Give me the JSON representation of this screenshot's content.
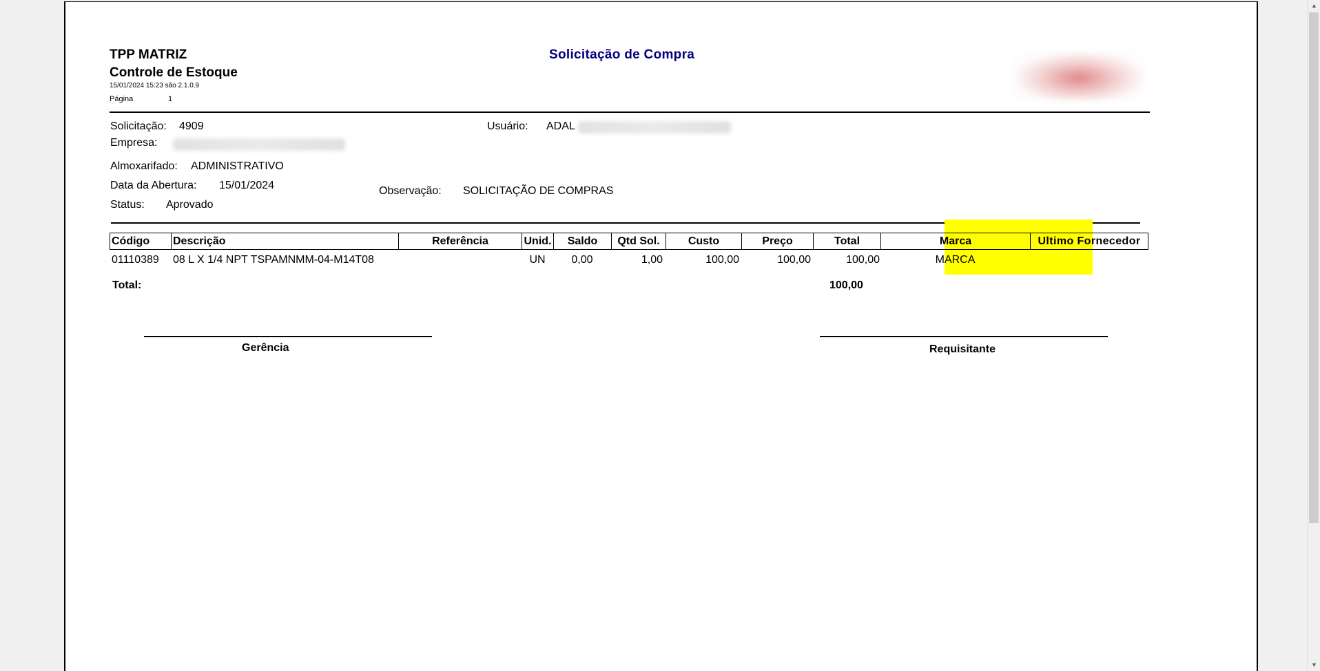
{
  "header": {
    "company": "TPP MATRIZ",
    "module": "Controle de Estoque",
    "datetime_version": "15/01/2024 15:23 são 2.1.0.9",
    "page_label": "Página",
    "page_number": "1",
    "report_title": "Solicitação de Compra"
  },
  "fields": {
    "solicitacao_label": "Solicitação:",
    "solicitacao_value": "4909",
    "usuario_label": "Usuário:",
    "usuario_value": "ADAL",
    "empresa_label": "Empresa:",
    "almoxarifado_label": "Almoxarifado:",
    "almoxarifado_value": "ADMINISTRATIVO",
    "data_abertura_label": "Data da Abertura:",
    "data_abertura_value": "15/01/2024",
    "observacao_label": "Observação:",
    "observacao_value": "SOLICITAÇÃO DE COMPRAS",
    "status_label": "Status:",
    "status_value": "Aprovado"
  },
  "table": {
    "columns": [
      "Código",
      "Descrição",
      "Referência",
      "Unid.",
      "Saldo",
      "Qtd Sol.",
      "Custo",
      "Preço",
      "Total",
      "Marca",
      "Ultimo Fornecedor"
    ],
    "rows": [
      {
        "codigo": "01110389",
        "descricao": "08 L X 1/4 NPT TSPAMNMM-04-M14T08",
        "referencia": "",
        "unid": "UN",
        "saldo": "0,00",
        "qtd_sol": "1,00",
        "custo": "100,00",
        "preco": "100,00",
        "total": "100,00",
        "marca": "MARCA",
        "ultimo_fornecedor": ""
      }
    ],
    "total_label": "Total:",
    "total_value": "100,00"
  },
  "signatures": {
    "left": "Gerência",
    "right": "Requisitante"
  },
  "colors": {
    "title": "#00007a",
    "highlight": "#ffff00"
  }
}
